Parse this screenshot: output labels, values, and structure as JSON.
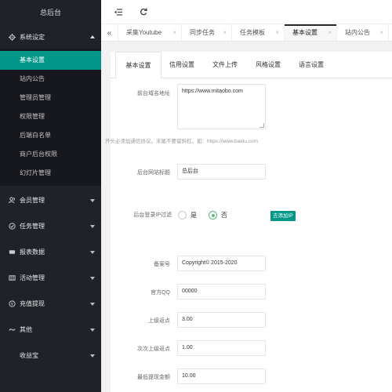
{
  "app_title": "总后台",
  "sidebar": {
    "groups": [
      {
        "label": "系统设定",
        "icon": "gear-icon",
        "open": true,
        "items": [
          "基本设置",
          "站内公告",
          "管理员管理",
          "权限管理",
          "后端白名单",
          "商户后台权限",
          "幻灯片管理"
        ]
      },
      {
        "label": "会员管理",
        "icon": "users-icon"
      },
      {
        "label": "任务管理",
        "icon": "task-icon"
      },
      {
        "label": "报表数据",
        "icon": "report-icon"
      },
      {
        "label": "活动管理",
        "icon": "activity-icon"
      },
      {
        "label": "充值提现",
        "icon": "recharge-icon"
      },
      {
        "label": "其他",
        "icon": "other-icon"
      },
      {
        "label": "收益宝",
        "icon": "none"
      }
    ],
    "active_item": "基本设置"
  },
  "header": {
    "fold_icon": "menu-fold-icon",
    "refresh_icon": "refresh-icon"
  },
  "tabs": {
    "items": [
      {
        "label": "采集Youtube",
        "close": "×"
      },
      {
        "label": "同步任务",
        "close": "×"
      },
      {
        "label": "任务模板",
        "close": "×"
      },
      {
        "label": "基本设置",
        "close": "×"
      },
      {
        "label": "站内公告",
        "close": "×"
      }
    ],
    "active": "基本设置"
  },
  "settings_tabs": [
    "基本设置",
    "信用设置",
    "文件上传",
    "风格设置",
    "语言设置"
  ],
  "form": {
    "site_domain_label": "前台域名地址",
    "site_domain_value": "https://www.mitaobo.com",
    "site_domain_hint": "开头必须加通信协议。末尾不要留斜杠。如：https://www.baidu.com",
    "admin_name_label": "后台网站标题",
    "admin_name_value": "总后台",
    "ip_limit_label": "后台登录IP过滤",
    "ip_yes": "是",
    "ip_no": "否",
    "ip_selected": "否",
    "add_ip_button": "去添加IP",
    "record_label": "备案号",
    "record_value": "Copyright© 2015-2020",
    "qq_label": "官方QQ",
    "qq_value": "00000",
    "rebate1_label": "上级返点",
    "rebate1_value": "3.00",
    "rebate2_label": "次次上级返点",
    "rebate2_value": "1.00",
    "min_withdraw_label": "最低提现金额",
    "min_withdraw_value": "10.00"
  }
}
